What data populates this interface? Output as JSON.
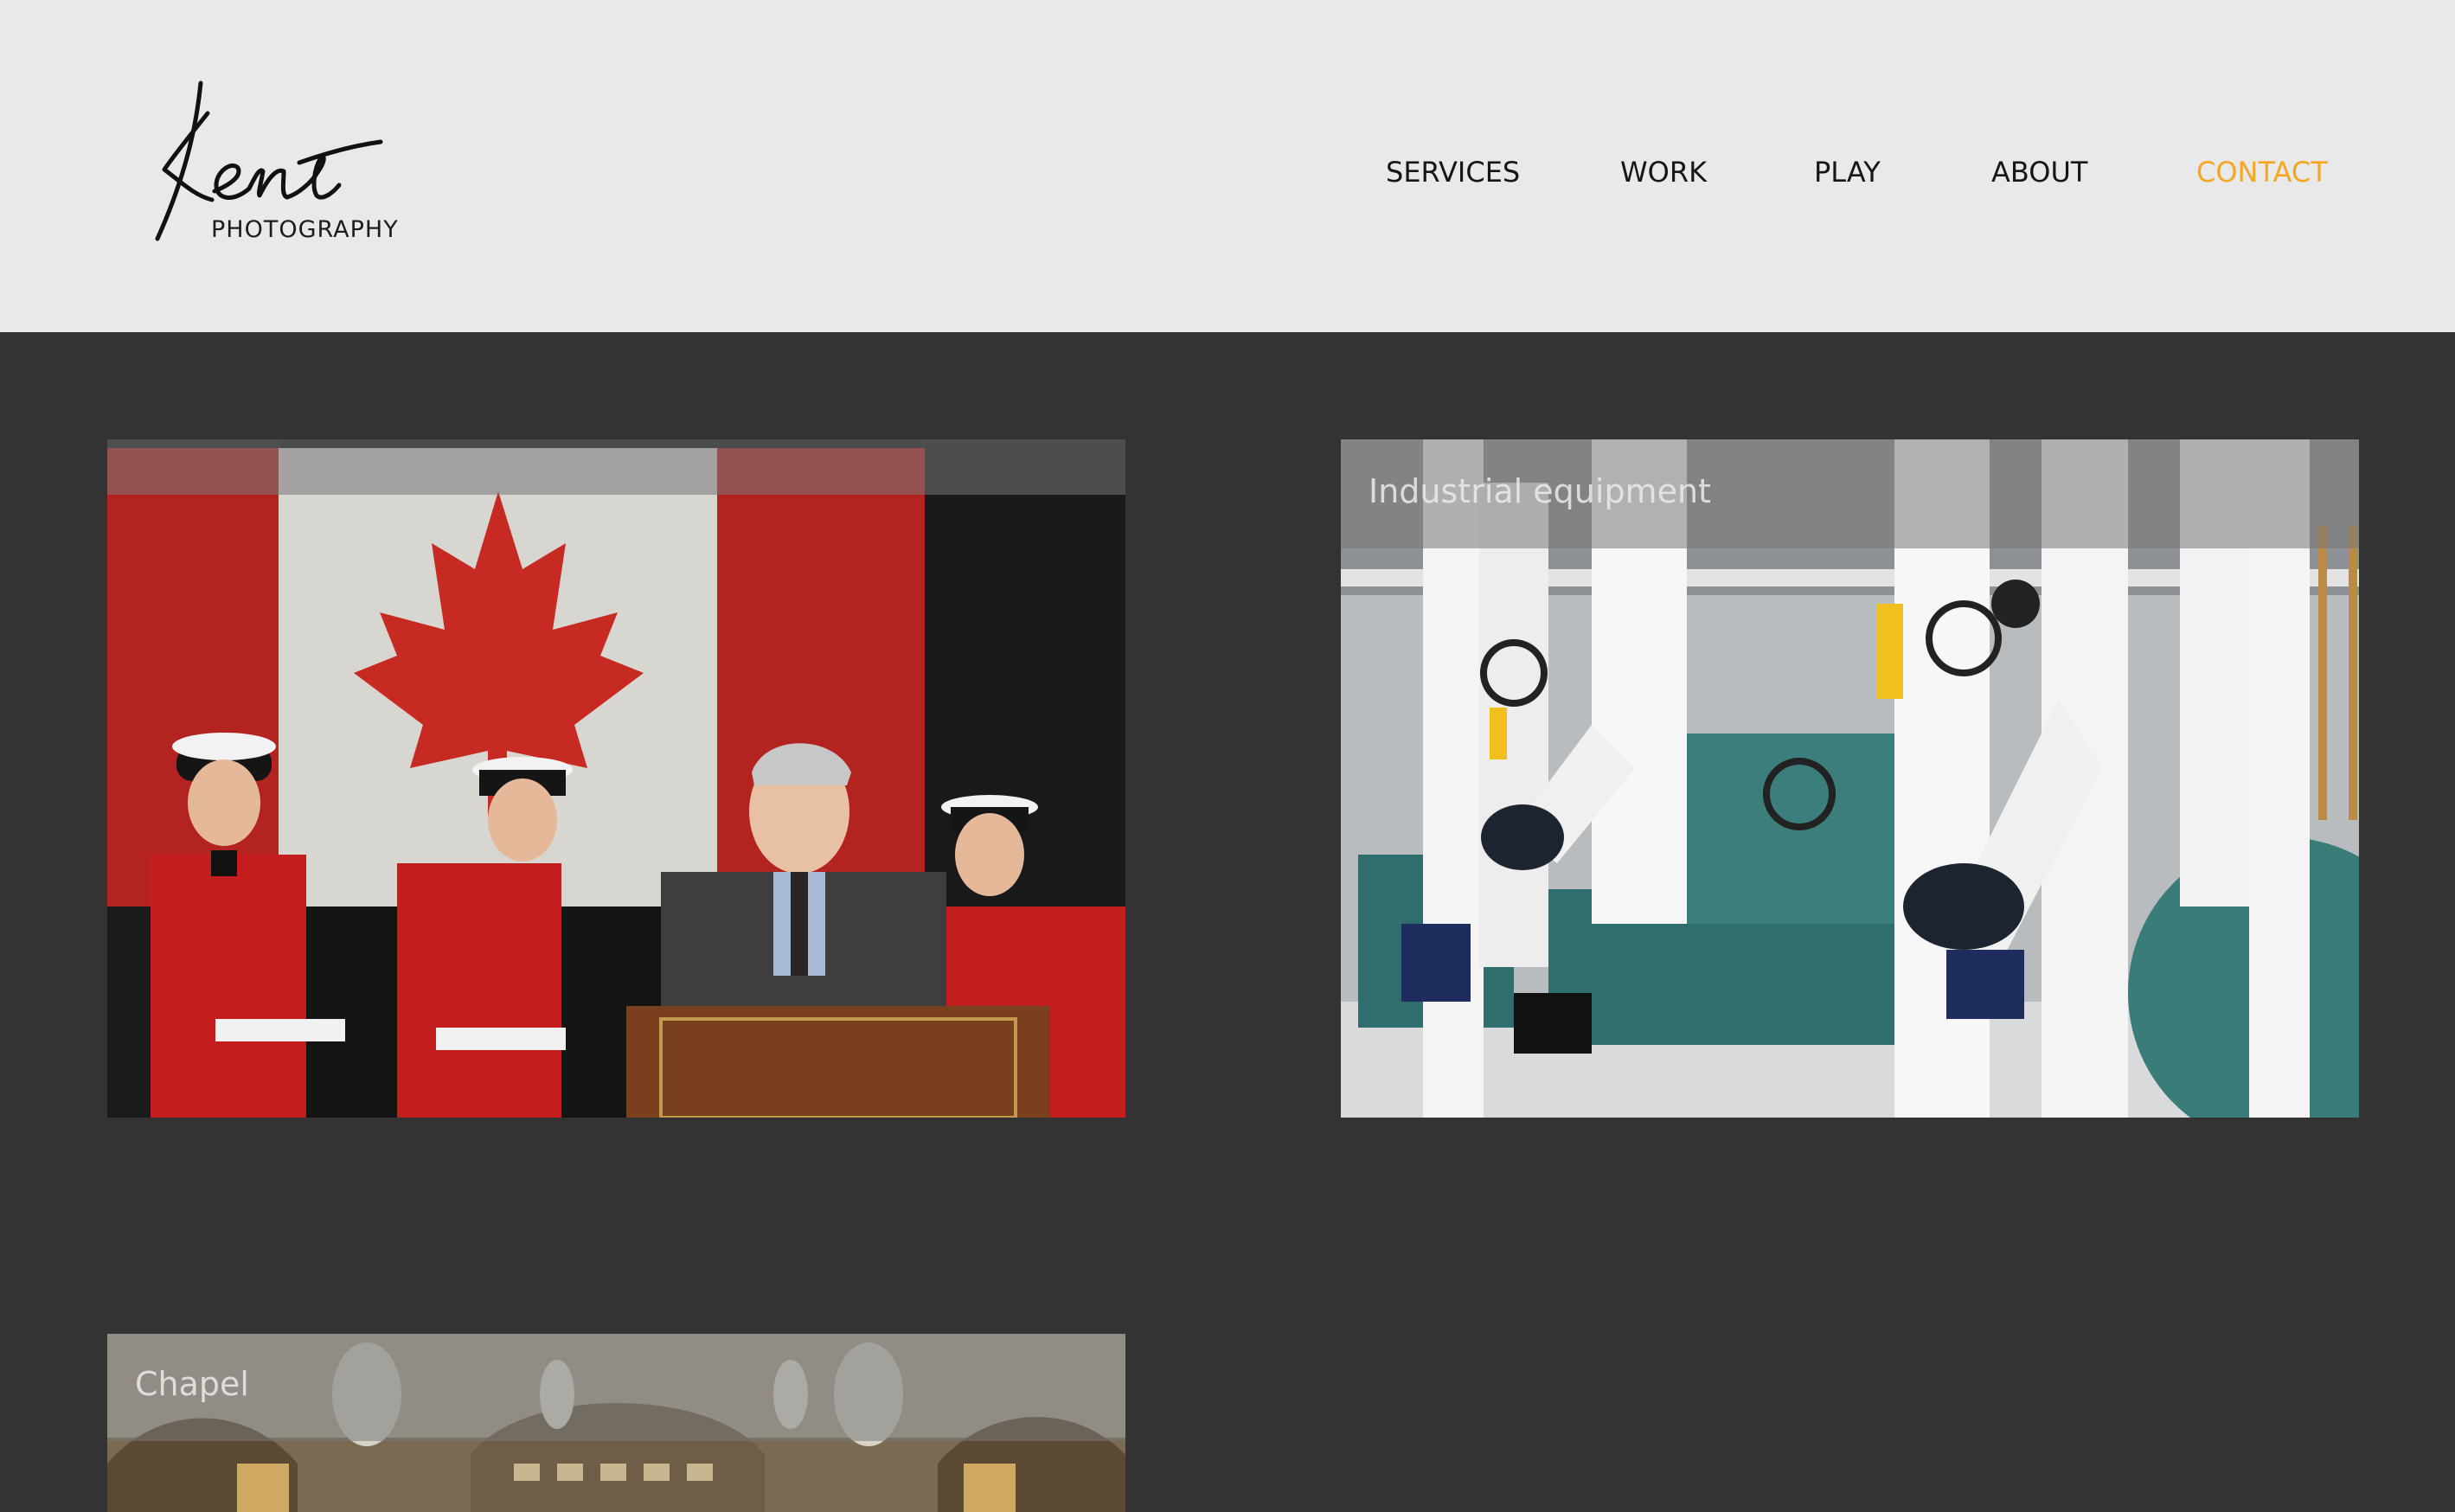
{
  "brand": {
    "script": "Kent",
    "subtitle": "PHOTOGRAPHY"
  },
  "nav": {
    "items": [
      "SERVICES",
      "WORK",
      "PLAY",
      "ABOUT",
      "CONTACT"
    ],
    "active": "CONTACT",
    "active_color": "#f5a623"
  },
  "gallery": {
    "items": [
      {
        "caption": ""
      },
      {
        "caption": "Industrial equipment"
      },
      {
        "caption": "Chapel"
      }
    ]
  },
  "colors": {
    "header_bg": "#e9e9e9",
    "page_bg": "#333333"
  }
}
